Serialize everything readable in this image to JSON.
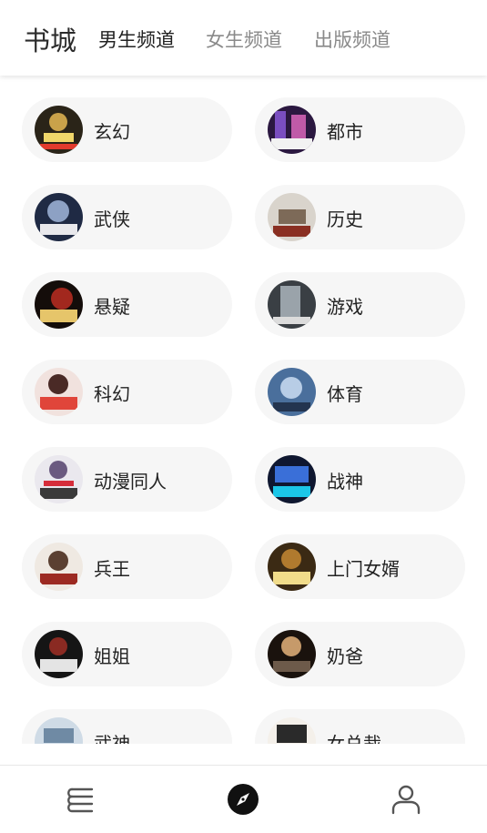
{
  "header": {
    "title": "书城",
    "tabs": [
      {
        "label": "男生频道",
        "active": true
      },
      {
        "label": "女生频道",
        "active": false
      },
      {
        "label": "出版频道",
        "active": false
      }
    ]
  },
  "categories": [
    {
      "label": "玄幻"
    },
    {
      "label": "都市"
    },
    {
      "label": "武侠"
    },
    {
      "label": "历史"
    },
    {
      "label": "悬疑"
    },
    {
      "label": "游戏"
    },
    {
      "label": "科幻"
    },
    {
      "label": "体育"
    },
    {
      "label": "动漫同人"
    },
    {
      "label": "战神"
    },
    {
      "label": "兵王"
    },
    {
      "label": "上门女婿"
    },
    {
      "label": "姐姐"
    },
    {
      "label": "奶爸"
    },
    {
      "label": "武神"
    },
    {
      "label": "女总裁"
    }
  ],
  "bottom_nav": [
    {
      "icon": "bookshelf-icon",
      "active": false
    },
    {
      "icon": "compass-icon",
      "active": true
    },
    {
      "icon": "user-icon",
      "active": false
    }
  ],
  "colors": {
    "active_text": "#222222",
    "inactive_text": "#8a8a8a",
    "pill_bg": "#f6f6f6"
  }
}
